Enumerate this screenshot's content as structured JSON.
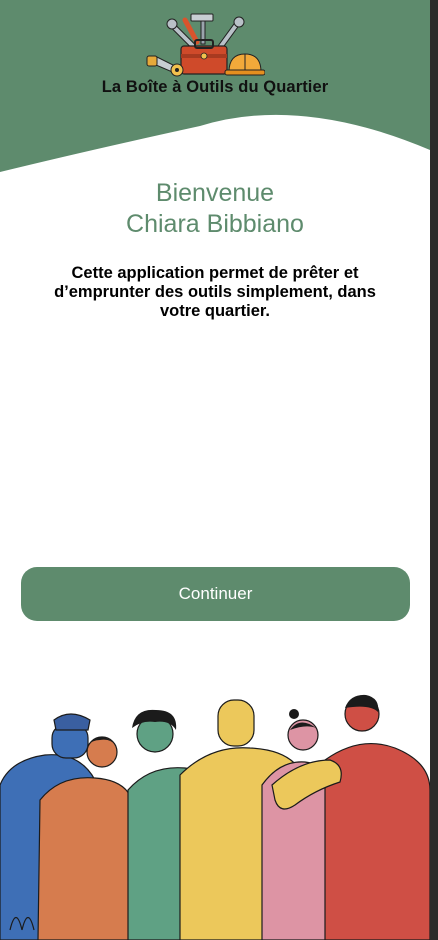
{
  "header": {
    "app_title": "La Boîte à Outils du Quartier",
    "logo_icon": "toolbox-icon"
  },
  "welcome": {
    "greeting": "Bienvenue",
    "user_name": "Chiara Bibbiano"
  },
  "description": "Cette application permet de prêter et d’emprunter des outils simplement, dans votre quartier.",
  "actions": {
    "continue_label": "Continuer"
  },
  "illustration": {
    "icon": "community-people-illustration"
  },
  "colors": {
    "header_green": "#5e8b6d",
    "button_green": "#5e8b6d",
    "title_green": "#5e8b6d"
  }
}
